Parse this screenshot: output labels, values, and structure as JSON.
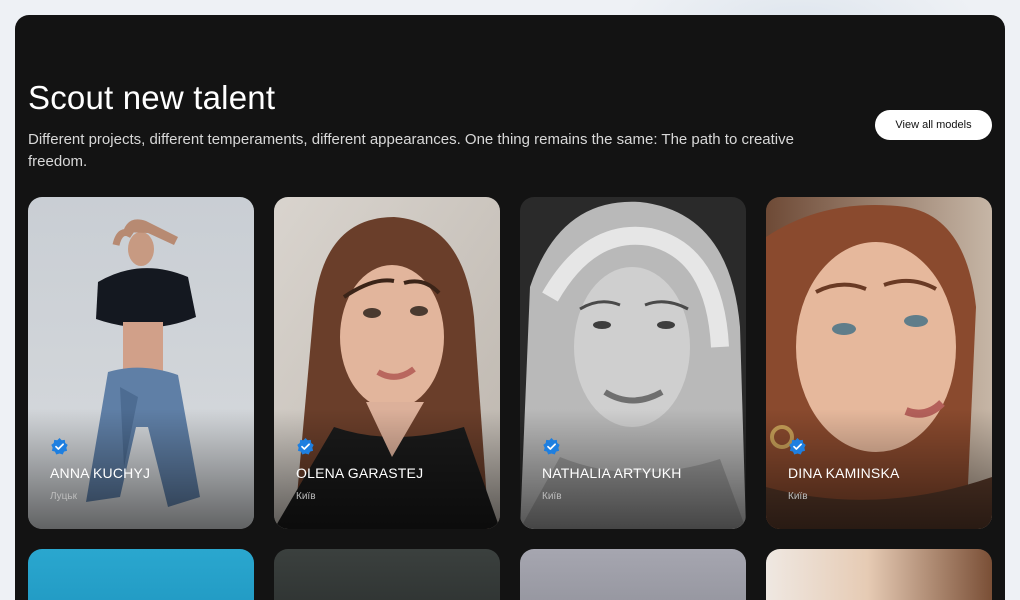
{
  "section": {
    "title": "Scout new talent",
    "subtitle": "Different projects, different temperaments, different appearances. One thing remains the same: The path to creative freedom.",
    "view_all_label": "View all models"
  },
  "models": [
    {
      "name": "ANNA KUCHYJ",
      "city": "Луцьк"
    },
    {
      "name": "OLENA GARASTEJ",
      "city": "Київ"
    },
    {
      "name": "NATHALIA ARTYUKH",
      "city": "Київ"
    },
    {
      "name": "DINA KAMINSKA",
      "city": "Київ"
    }
  ],
  "icons": {
    "verified": "verified-badge-icon"
  },
  "colors": {
    "panel_bg": "#131313",
    "badge_blue": "#1e7fe0",
    "button_bg": "#ffffff"
  }
}
